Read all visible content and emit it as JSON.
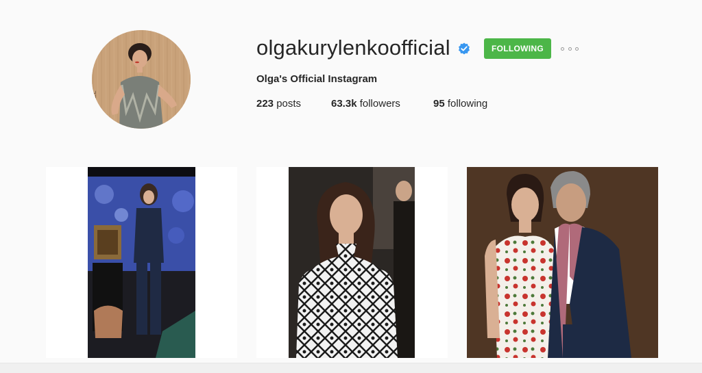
{
  "profile": {
    "username": "olgakurylenkoofficial",
    "full_name": "Olga's Official Instagram",
    "verified": true,
    "follow_button_label": "FOLLOWING",
    "posts_count": "223",
    "posts_label": "posts",
    "followers_count": "63.3k",
    "followers_label": "followers",
    "following_count": "95",
    "following_label": "following"
  },
  "colors": {
    "following_button": "#4cb648",
    "verified_badge": "#3897f0",
    "background": "#fafafa"
  },
  "icons": {
    "verified": "verified-badge-icon",
    "more": "more-options-icon"
  },
  "posts": [
    {
      "alt": "photo-post-1"
    },
    {
      "alt": "photo-post-2"
    },
    {
      "alt": "photo-post-3"
    }
  ]
}
